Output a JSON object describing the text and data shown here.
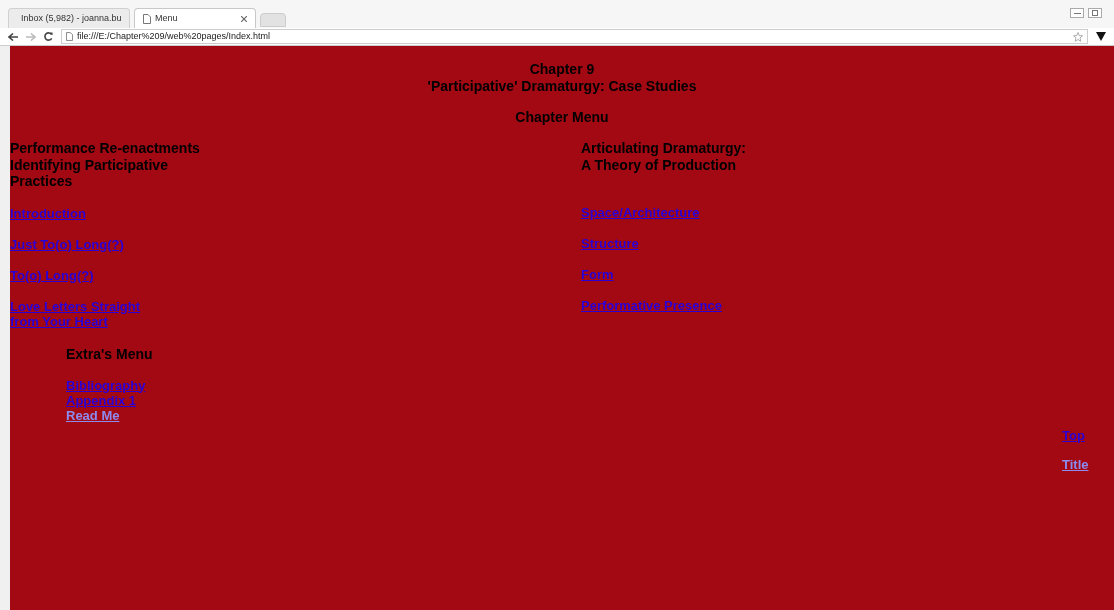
{
  "browser": {
    "tabs": [
      {
        "label": "Inbox (5,982) - joanna.bu",
        "kind": "mail",
        "selected": false
      },
      {
        "label": "Menu",
        "kind": "page",
        "selected": true
      }
    ],
    "address": "file:///E:/Chapter%209/web%20pages/Index.html"
  },
  "page": {
    "title_lines": [
      "Chapter 9",
      "'Participative' Dramaturgy: Case Studies"
    ],
    "menu_heading": "Chapter Menu",
    "columns": [
      {
        "heading_lines": [
          "Performance Re-enactments",
          "Identifying Participative",
          "Practices"
        ],
        "links": [
          {
            "lines": [
              "Introduction"
            ],
            "faded": false
          },
          {
            "lines": [
              "Just To(o) Long(?)"
            ],
            "faded": false
          },
          {
            "lines": [
              "To(o) Long(?)"
            ],
            "faded": false
          },
          {
            "lines": [
              "Love Letters Straight",
              "from Your Heart"
            ],
            "faded": false
          }
        ]
      },
      {
        "heading_lines": [
          "Articulating Dramaturgy:",
          "A Theory of Production"
        ],
        "links": [
          {
            "lines": [
              "Space/Architecture"
            ],
            "faded": false
          },
          {
            "lines": [
              "Structure"
            ],
            "faded": false
          },
          {
            "lines": [
              "Form"
            ],
            "faded": false
          },
          {
            "lines": [
              "Performative Presence"
            ],
            "faded": false
          }
        ]
      }
    ],
    "extras": {
      "heading": "Extra's Menu",
      "links": [
        {
          "label": "Bibliography",
          "faded": false
        },
        {
          "label": "Appendix 1",
          "faded": false
        },
        {
          "label": "Read Me",
          "faded": true
        }
      ]
    },
    "corner_links": [
      {
        "label": "Top",
        "faded": false
      },
      {
        "label": "Title",
        "faded": true
      }
    ]
  }
}
